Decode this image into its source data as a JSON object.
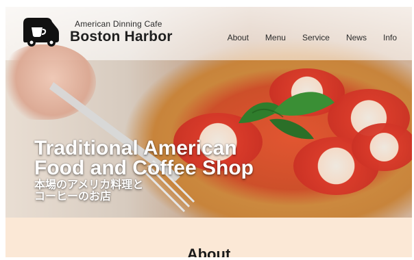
{
  "brand": {
    "small": "American Dinning Cafe",
    "big": "Boston Harbor"
  },
  "nav": {
    "items": [
      "About",
      "Menu",
      "Service",
      "News",
      "Info"
    ]
  },
  "hero": {
    "headline_line1": "Traditional American",
    "headline_line2": "Food and Coffee Shop",
    "subhead_line1": "本場のアメリカ料理と",
    "subhead_line2": "コーヒーのお店"
  },
  "section": {
    "title": "About"
  }
}
